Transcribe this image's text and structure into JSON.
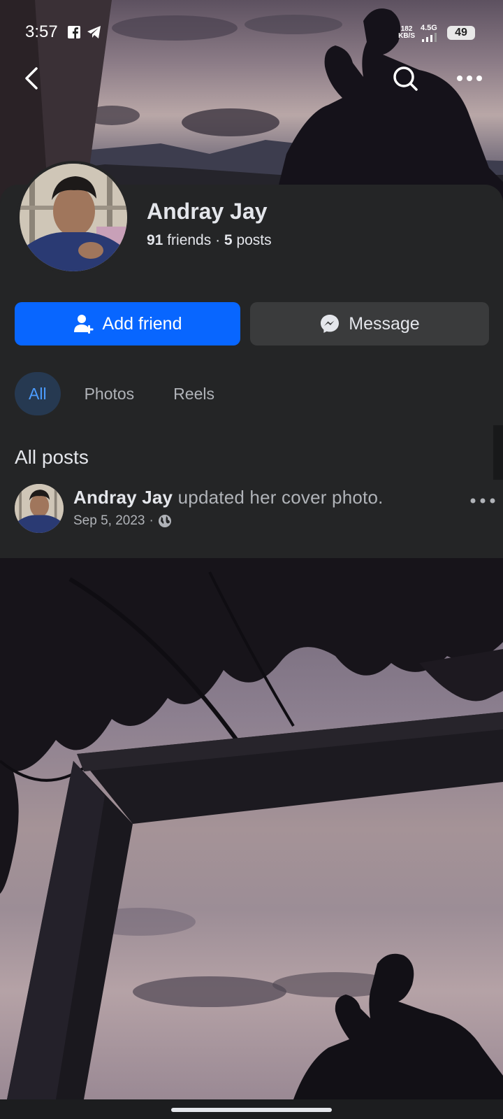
{
  "status_bar": {
    "time": "3:57",
    "net_speed_value": "182",
    "net_speed_unit": "KB/S",
    "network_type": "4.5G",
    "battery": "49"
  },
  "nav": {
    "back_icon": "chevron-left-icon",
    "search_icon": "search-icon",
    "more_icon": "more-horizontal-icon"
  },
  "profile": {
    "name": "Andray Jay",
    "friends_count": "91",
    "friends_label": "friends",
    "separator": "·",
    "posts_count": "5",
    "posts_label": "posts"
  },
  "actions": {
    "add_friend_label": "Add friend",
    "message_label": "Message"
  },
  "tabs": [
    {
      "label": "All",
      "active": true
    },
    {
      "label": "Photos",
      "active": false
    },
    {
      "label": "Reels",
      "active": false
    }
  ],
  "feed": {
    "title": "All posts",
    "post": {
      "author": "Andray Jay",
      "action_text": "updated her cover photo.",
      "date": "Sep 5, 2023",
      "meta_separator": "·",
      "privacy_icon": "globe-icon"
    }
  },
  "colors": {
    "background": "#242526",
    "primary_button": "#0866ff",
    "secondary_button": "#3a3b3c",
    "active_tab_bg": "#263951",
    "active_tab_text": "#4c9cff"
  }
}
